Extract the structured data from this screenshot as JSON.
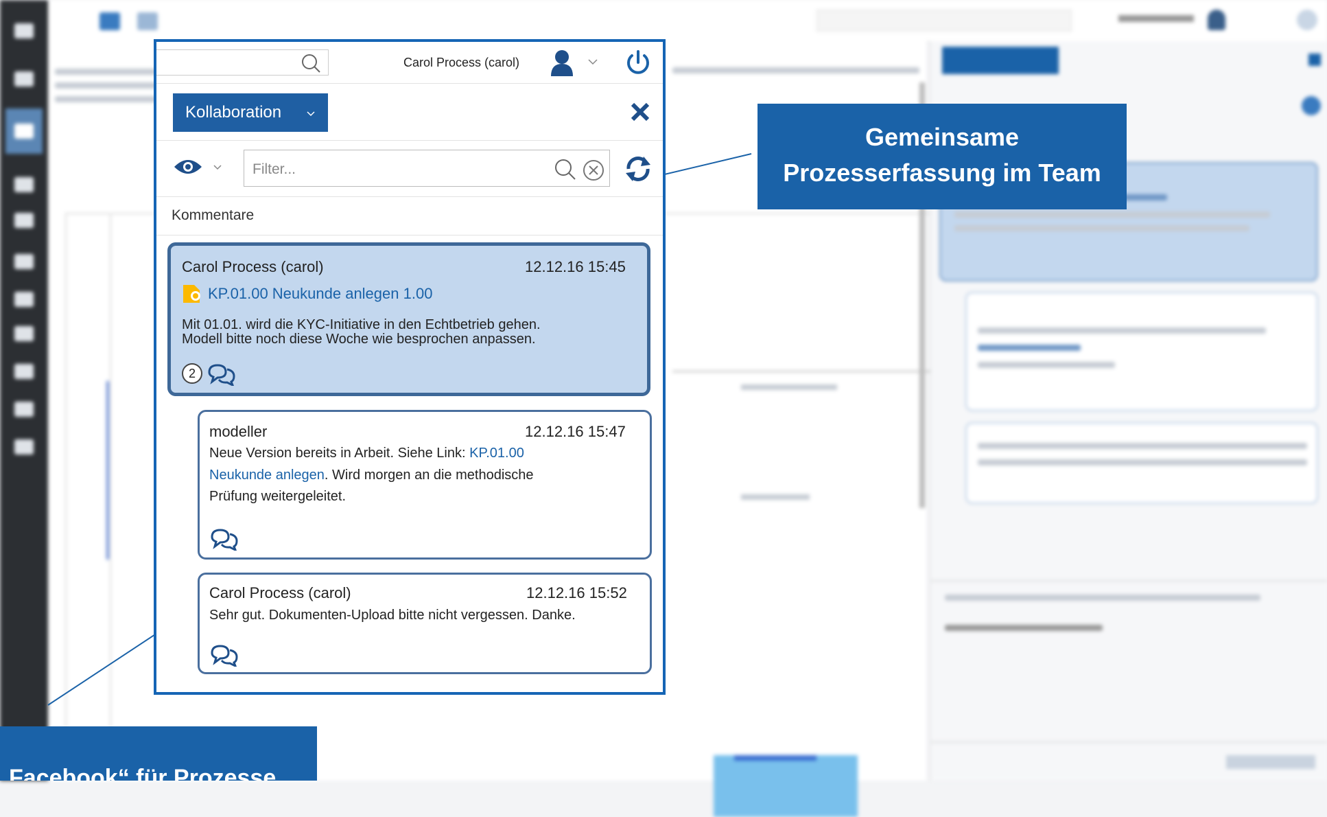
{
  "search": {
    "placeholder": ""
  },
  "user": {
    "name": "Carol Process (carol)"
  },
  "collab": {
    "dropdown_label": "Kollaboration",
    "filter_placeholder": "Filter...",
    "section_title": "Kommentare"
  },
  "comments": [
    {
      "author": "Carol Process (carol)",
      "time": "12.12.16 15:45",
      "object_link": "KP.01.00 Neukunde anlegen 1.00",
      "line1": "Mit 01.01. wird die KYC-Initiative in den Echtbetrieb gehen.",
      "line2": "Modell bitte noch diese Woche wie besprochen anpassen.",
      "reply_count": "2"
    },
    {
      "author": "modeller",
      "time": "12.12.16 15:47",
      "text_pre": "Neue Version bereits in Arbeit. Siehe Link: ",
      "link_part1": "KP.01.00",
      "link_part2": "Neukunde anlegen",
      "text_post": ". Wird morgen an die methodische",
      "line3": "Prüfung weitergeleitet."
    },
    {
      "author": "Carol Process (carol)",
      "time": "12.12.16 15:52",
      "text": "Sehr gut. Dokumenten-Upload bitte nicht vergessen. Danke."
    }
  ],
  "callouts": {
    "team_line1": "Gemeinsame",
    "team_line2": "Prozesserfassung im Team",
    "facebook": "„Facebook“ für Prozesse"
  },
  "colors": {
    "accent": "#1a62a8",
    "selected_card": "#c3d7ee",
    "panel_border": "#1565b5"
  },
  "icons": [
    "search-icon",
    "user-icon",
    "chevron-down-icon",
    "power-icon",
    "close-icon",
    "eye-icon",
    "clear-icon",
    "refresh-icon",
    "document-icon",
    "comment-icon"
  ]
}
